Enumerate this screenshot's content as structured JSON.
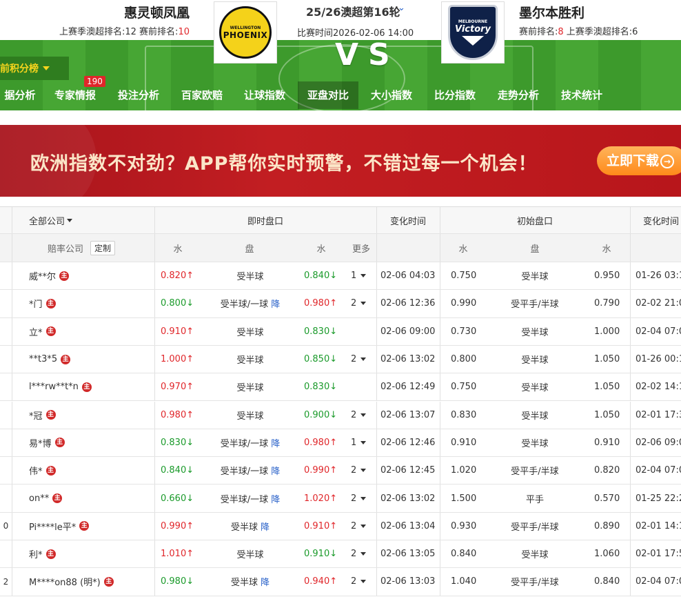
{
  "header": {
    "home_team": "惠灵顿凤凰",
    "away_team": "墨尔本胜利",
    "home_rank_prefix": "上赛季澳超排名:12  赛前排名:",
    "home_rank_value": "10",
    "away_rank_prefix": "赛前排名:",
    "away_rank_value": "8",
    "away_rank_suffix": "  上赛季澳超排名:6",
    "round": "25/26澳超第16轮",
    "match_time": "比赛时间2026-02-06 14:00",
    "vs": "VS",
    "home_logo_small": "WELLINGTON",
    "home_logo_big": "PHOENIX",
    "away_logo_small": "MELBOURNE",
    "away_logo_big": "Victory",
    "standings_button": "前积分榜",
    "badge_count": "190"
  },
  "nav": {
    "tabs": [
      "据分析",
      "专家情报",
      "投注分析",
      "百家欧赔",
      "让球指数",
      "亚盘对比",
      "大小指数",
      "比分指数",
      "走势分析",
      "技术统计"
    ],
    "active_index": 5
  },
  "banner": {
    "text": "欧洲指数不对劲？APP帮你实时预警，不错过每一个机会！",
    "button": "立即下载"
  },
  "table": {
    "header1": {
      "all_company": "全部公司",
      "live": "即时盘口",
      "change_time": "变化时间",
      "initial": "初始盘口",
      "change_time2": "变化时间"
    },
    "header2": {
      "company": "赔率公司",
      "customize": "定制",
      "water1": "水",
      "line": "盘",
      "water2": "水",
      "more": "更多",
      "init_water1": "水",
      "init_line": "盘",
      "init_water2": "水"
    },
    "rows": [
      {
        "edge": "",
        "company": "威**尔",
        "w1": "0.820↑",
        "w1_dir": "up",
        "line": "受半球",
        "drop": "",
        "w2": "0.840↓",
        "w2_dir": "down",
        "more": "1",
        "time": "02-06 04:03",
        "iw1": "0.750",
        "iline": "受半球",
        "iw2": "0.950",
        "itime": "01-26 03:1"
      },
      {
        "edge": "",
        "company": "*门",
        "w1": "0.800↓",
        "w1_dir": "down",
        "line": "受半球/一球",
        "drop": "降",
        "w2": "0.980↑",
        "w2_dir": "up",
        "more": "2",
        "time": "02-06 12:36",
        "iw1": "0.990",
        "iline": "受平手/半球",
        "iw2": "0.790",
        "itime": "02-02 21:0"
      },
      {
        "edge": "",
        "company": "立*",
        "w1": "0.910↑",
        "w1_dir": "up",
        "line": "受半球",
        "drop": "",
        "w2": "0.830↓",
        "w2_dir": "down",
        "more": "",
        "time": "02-06 09:00",
        "iw1": "0.730",
        "iline": "受半球",
        "iw2": "1.000",
        "itime": "02-04 07:0"
      },
      {
        "edge": "",
        "company": "**t3*5",
        "w1": "1.000↑",
        "w1_dir": "up",
        "line": "受半球",
        "drop": "",
        "w2": "0.850↓",
        "w2_dir": "down",
        "more": "2",
        "time": "02-06 13:02",
        "iw1": "0.800",
        "iline": "受半球",
        "iw2": "1.050",
        "itime": "01-26 00:1"
      },
      {
        "edge": "",
        "company": "l***rw**t*n",
        "w1": "0.970↑",
        "w1_dir": "up",
        "line": "受半球",
        "drop": "",
        "w2": "0.830↓",
        "w2_dir": "down",
        "more": "",
        "time": "02-06 12:49",
        "iw1": "0.750",
        "iline": "受半球",
        "iw2": "1.050",
        "itime": "02-02 14:1"
      },
      {
        "edge": "",
        "company": "*冠",
        "w1": "0.980↑",
        "w1_dir": "up",
        "line": "受半球",
        "drop": "",
        "w2": "0.900↓",
        "w2_dir": "down",
        "more": "2",
        "time": "02-06 13:07",
        "iw1": "0.830",
        "iline": "受半球",
        "iw2": "1.050",
        "itime": "02-01 17:3"
      },
      {
        "edge": "",
        "company": "易*博",
        "w1": "0.830↓",
        "w1_dir": "down",
        "line": "受半球/一球",
        "drop": "降",
        "w2": "0.980↑",
        "w2_dir": "up",
        "more": "1",
        "time": "02-06 12:46",
        "iw1": "0.910",
        "iline": "受半球",
        "iw2": "0.910",
        "itime": "02-06 09:0"
      },
      {
        "edge": "",
        "company": "伟*",
        "w1": "0.840↓",
        "w1_dir": "down",
        "line": "受半球/一球",
        "drop": "降",
        "w2": "0.990↑",
        "w2_dir": "up",
        "more": "2",
        "time": "02-06 12:45",
        "iw1": "1.020",
        "iline": "受平手/半球",
        "iw2": "0.820",
        "itime": "02-04 07:0"
      },
      {
        "edge": "",
        "company": "on**",
        "w1": "0.660↓",
        "w1_dir": "down",
        "line": "受半球/一球",
        "drop": "降",
        "w2": "1.020↑",
        "w2_dir": "up",
        "more": "2",
        "time": "02-06 13:02",
        "iw1": "1.500",
        "iline": "平手",
        "iw2": "0.570",
        "itime": "01-25 22:2"
      },
      {
        "edge": "0",
        "company": "Pi****le平*",
        "w1": "0.990↑",
        "w1_dir": "up",
        "line": "受半球",
        "drop": "降",
        "w2": "0.910↑",
        "w2_dir": "up",
        "more": "2",
        "time": "02-06 13:04",
        "iw1": "0.930",
        "iline": "受平手/半球",
        "iw2": "0.890",
        "itime": "02-01 14:1"
      },
      {
        "edge": "",
        "company": "利*",
        "w1": "1.010↑",
        "w1_dir": "up",
        "line": "受半球",
        "drop": "",
        "w2": "0.910↓",
        "w2_dir": "down",
        "more": "2",
        "time": "02-06 13:05",
        "iw1": "0.840",
        "iline": "受半球",
        "iw2": "1.060",
        "itime": "02-01 17:5"
      },
      {
        "edge": "2",
        "company": "M****on88 (明*)",
        "w1": "0.980↓",
        "w1_dir": "down",
        "line": "受半球",
        "drop": "降",
        "w2": "0.940↑",
        "w2_dir": "up",
        "more": "2",
        "time": "02-06 13:03",
        "iw1": "1.040",
        "iline": "受平手/半球",
        "iw2": "0.840",
        "itime": "02-04 07:0"
      }
    ],
    "main_icon_glyph": "主"
  },
  "colors": {
    "up": "#e0262a",
    "down": "#1a9a2a",
    "drop_tag": "#2a62c9",
    "banner": "#b8161b",
    "pitch": "#3d9a2c"
  }
}
